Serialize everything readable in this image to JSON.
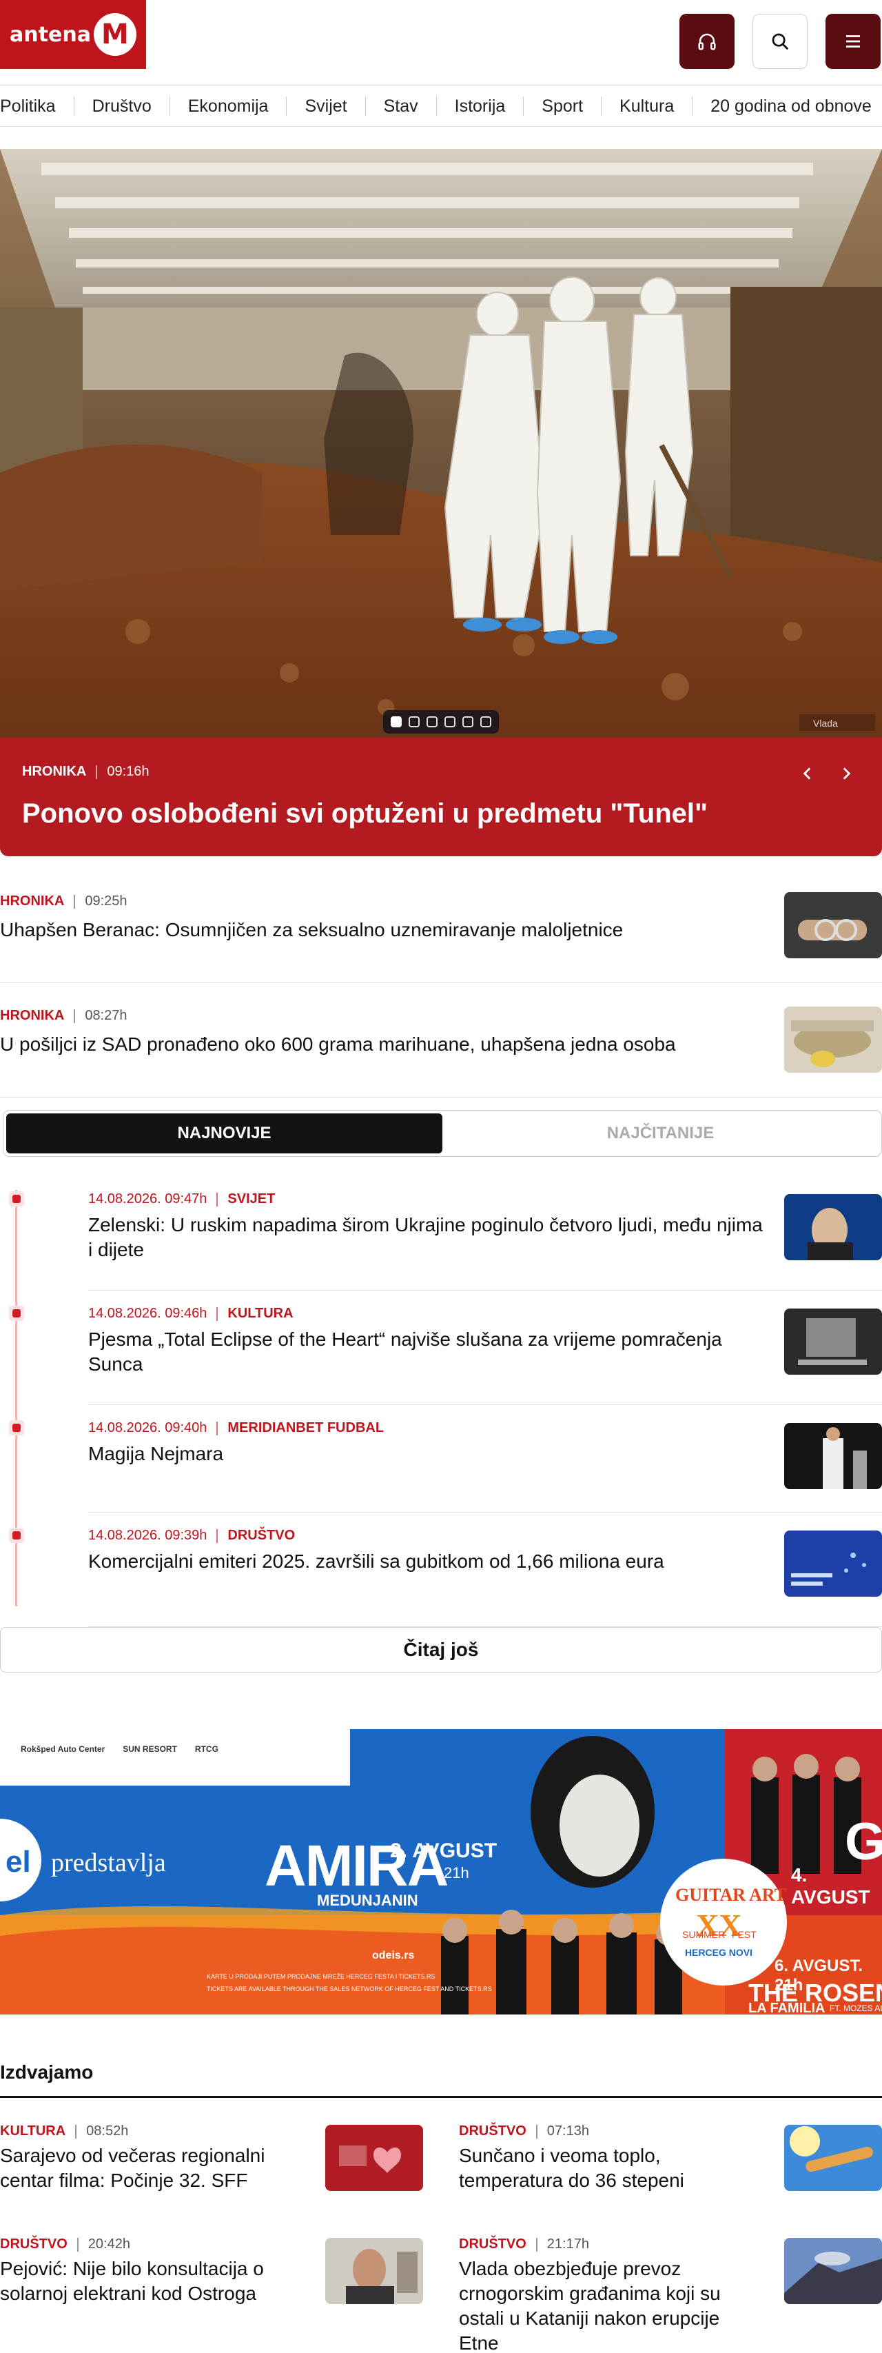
{
  "header": {
    "logo_text": "antena",
    "logo_letter": "M",
    "nav": [
      "Politika",
      "Društvo",
      "Ekonomija",
      "Svijet",
      "Stav",
      "Istorija",
      "Sport",
      "Kultura",
      "20 godina od obnove"
    ]
  },
  "hero": {
    "category": "HRONIKA",
    "time": "09:16h",
    "title": "Ponovo oslobođeni svi optuženi u predmetu \"Tunel\"",
    "slide_count": 6,
    "active_slide": 1,
    "watermark": "Vlada"
  },
  "lead_articles": [
    {
      "category": "HRONIKA",
      "time": "09:25h",
      "title": "Uhapšen Beranac: Osumnjičen za seksualno uznemiravanje maloljetnice"
    },
    {
      "category": "HRONIKA",
      "time": "08:27h",
      "title": "U pošiljci iz SAD pronađeno oko 600 grama marihuane, uhapšena jedna osoba"
    }
  ],
  "tabs": {
    "latest": "NAJNOVIJE",
    "most_read": "NAJČITANIJE"
  },
  "latest": [
    {
      "datetime": "14.08.2026. 09:47h",
      "category": "SVIJET",
      "title": "Zelenski: U ruskim napadima širom Ukrajine poginulo četvoro ljudi, među njima i dijete"
    },
    {
      "datetime": "14.08.2026. 09:46h",
      "category": "KULTURA",
      "title": "Pjesma „Total Eclipse of the Heart“ najviše slušana za vrijeme pomračenja Sunca"
    },
    {
      "datetime": "14.08.2026. 09:40h",
      "category": "MERIDIANBET FUDBAL",
      "title": "Magija Nejmara"
    },
    {
      "datetime": "14.08.2026. 09:39h",
      "category": "DRUŠTVO",
      "title": "Komercijalni emiteri 2025. završili sa gubitkom od 1,66 miliona eura"
    }
  ],
  "more_button": "Čitaj još",
  "banner": {
    "sponsors": [
      "Rokšped Auto Center",
      "SUN RESORT",
      "RTCG"
    ],
    "left_text": "predstavlja",
    "left_letters": "el",
    "amira": "AMIRA",
    "amira_date": "2. AVGUST",
    "amira_time": "21h",
    "amira_sub": "MEDUNJANIN",
    "guitar_title": "GUITAR ART",
    "guitar_roman": "XX",
    "guitar_sub1": "SUMMER",
    "guitar_sub2": "FEST",
    "guitar_sub3": "HERCEG NOVI",
    "right_date": "4. AVGUST",
    "right_partial": "GI",
    "rosen_date": "6. AVGUST. 21h",
    "rosen_title": "THE ROSENB",
    "rosen_sub": "LA FAMILIA",
    "rosen_ft": "FT. MOZES AL",
    "ticket_site": "odeis.rs",
    "ticket_line1": "KARTE U PRODAJI PUTEM PRODAJNE MREŽE HERCEG FESTA I TICKETS.RS",
    "ticket_line2": "TICKETS ARE AVAILABLE THROUGH THE SALES NETWORK OF HERCEG FEST AND TICKETS.RS"
  },
  "featured": {
    "title": "Izdvajamo",
    "items": [
      {
        "category": "KULTURA",
        "time": "08:52h",
        "title": "Sarajevo od večeras regionalni centar filma: Počinje 32. SFF"
      },
      {
        "category": "DRUŠTVO",
        "time": "07:13h",
        "title": "Sunčano i veoma toplo, temperatura do 36 stepeni"
      },
      {
        "category": "DRUŠTVO",
        "time": "20:42h",
        "title": "Pejović: Nije bilo konsultacija o solarnoj elektrani kod Ostroga"
      },
      {
        "category": "DRUŠTVO",
        "time": "21:17h",
        "title": "Vlada obezbjeđuje prevoz crnogorskim građanima koji su ostali u Kataniji nakon erupcije Etne"
      }
    ]
  },
  "colors": {
    "brand": "#c0141c",
    "dark_brand": "#5a0d10",
    "hero_caption": "#b31b21"
  },
  "icons": [
    "headphones-icon",
    "search-icon",
    "menu-icon",
    "chevron-left-icon",
    "chevron-right-icon"
  ]
}
